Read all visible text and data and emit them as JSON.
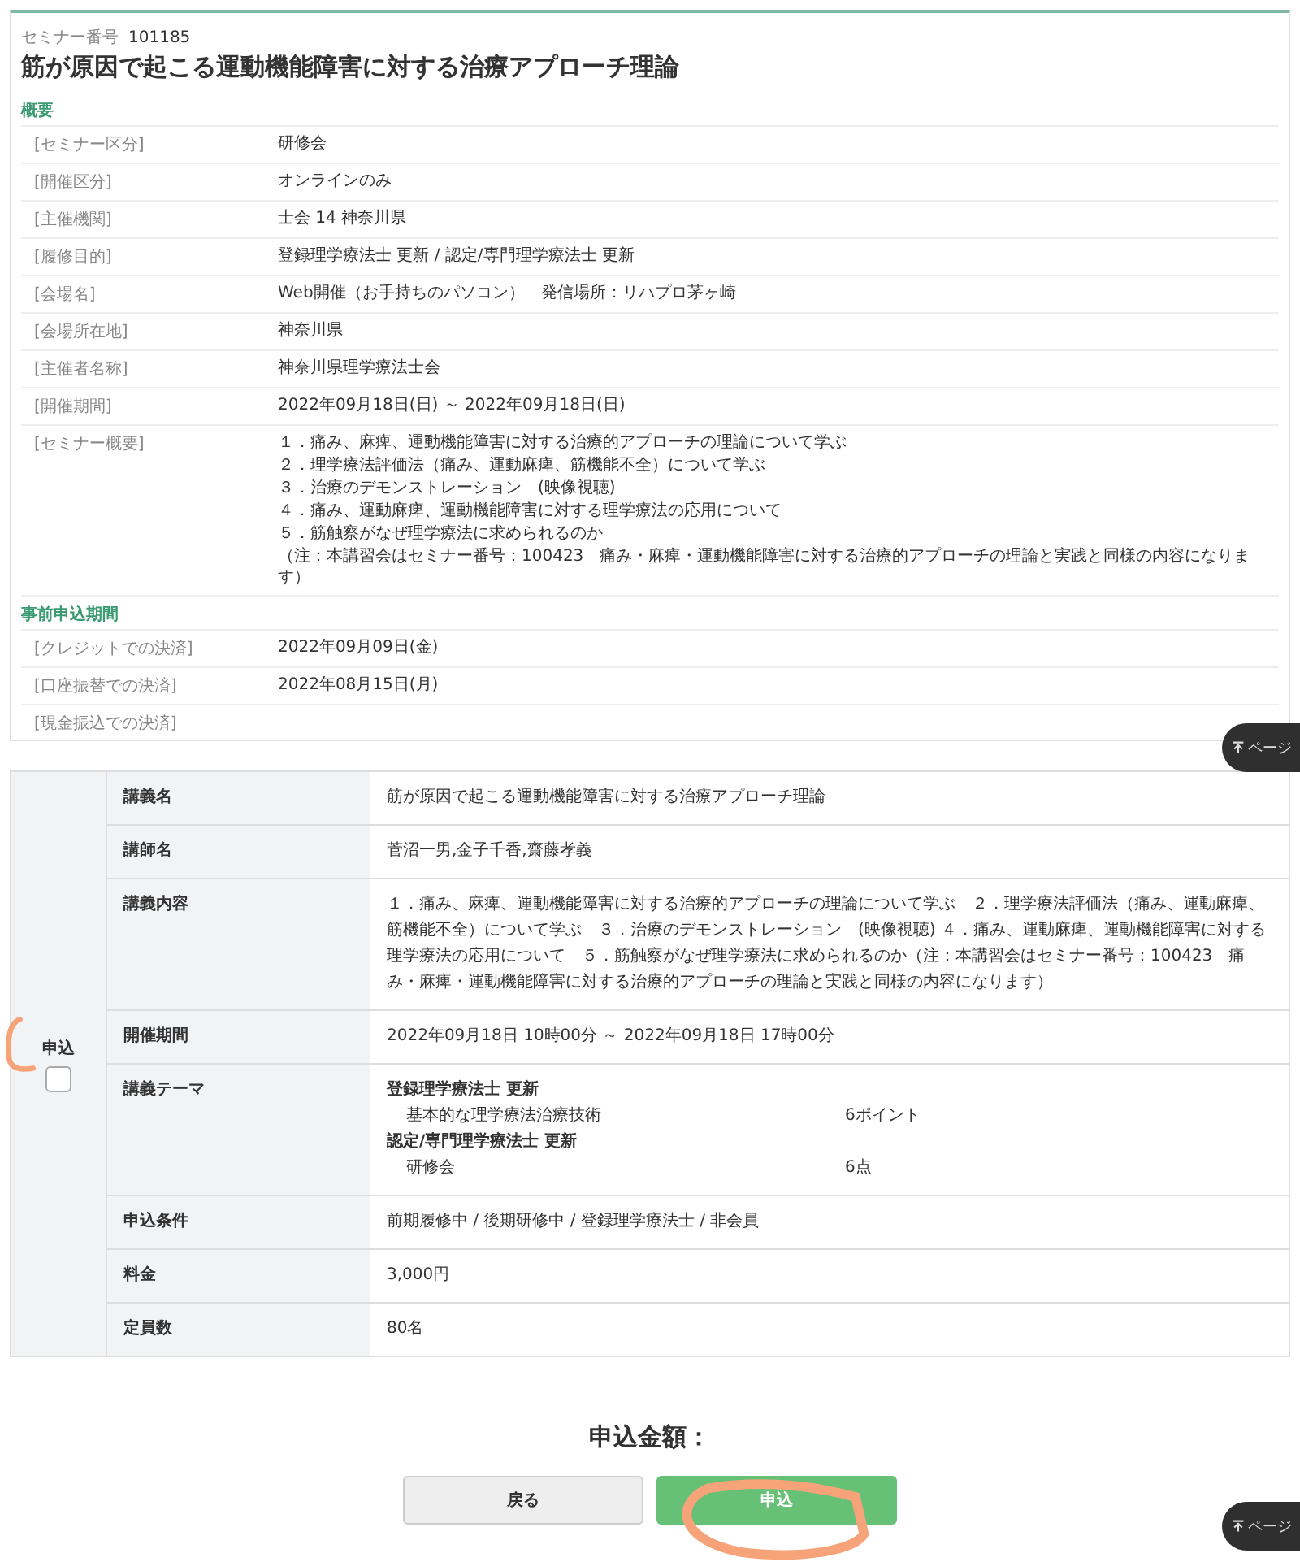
{
  "seminar_number": {
    "label": "セミナー番号",
    "value": "101185"
  },
  "title": "筋が原因で起こる運動機能障害に対する治療アプローチ理論",
  "overview": {
    "heading": "概要",
    "rows": [
      {
        "label": "[セミナー区分]",
        "value": "研修会"
      },
      {
        "label": "[開催区分]",
        "value": "オンラインのみ"
      },
      {
        "label": "[主催機関]",
        "value": "士会 14 神奈川県"
      },
      {
        "label": "[履修目的]",
        "value": "登録理学療法士 更新 / 認定/専門理学療法士 更新"
      },
      {
        "label": "[会場名]",
        "value": "Web開催（お手持ちのパソコン）　発信場所：リハプロ茅ヶ崎"
      },
      {
        "label": "[会場所在地]",
        "value": "神奈川県"
      },
      {
        "label": "[主催者名称]",
        "value": "神奈川県理学療法士会"
      },
      {
        "label": "[開催期間]",
        "value": "2022年09月18日(日) ～ 2022年09月18日(日)"
      },
      {
        "label": "[セミナー概要]",
        "lines": [
          "１．痛み、麻痺、運動機能障害に対する治療的アプローチの理論について学ぶ",
          "２．理学療法評価法（痛み、運動麻痺、筋機能不全）について学ぶ",
          "３．治療のデモンストレーション　(映像視聴)",
          "４．痛み、運動麻痺、運動機能障害に対する理学療法の応用について",
          "５．筋触察がなぜ理学療法に求められるのか",
          "（注：本講習会はセミナー番号：100423　痛み・麻痺・運動機能障害に対する治療的アプローチの理論と実践と同様の内容になります）"
        ]
      }
    ]
  },
  "application_period": {
    "heading": "事前申込期間",
    "rows": [
      {
        "label": "[クレジットでの決済]",
        "value": "2022年09月09日(金)"
      },
      {
        "label": "[口座振替での決済]",
        "value": "2022年08月15日(月)"
      },
      {
        "label": "[現金振込での決済]"
      }
    ]
  },
  "course": {
    "apply_label": "申込",
    "apply_checked": false,
    "rows": [
      {
        "label": "講義名",
        "value": "筋が原因で起こる運動機能障害に対する治療アプローチ理論"
      },
      {
        "label": "講師名",
        "value": "菅沼一男,金子千香,齋藤孝義"
      },
      {
        "label": "講義内容",
        "value": "１．痛み、麻痺、運動機能障害に対する治療的アプローチの理論について学ぶ　２．理学療法評価法（痛み、運動麻痺、筋機能不全）について学ぶ　３．治療のデモンストレーション　(映像視聴) ４．痛み、運動麻痺、運動機能障害に対する理学療法の応用について　５．筋触察がなぜ理学療法に求められるのか（注：本講習会はセミナー番号：100423　痛み・麻痺・運動機能障害に対する治療的アプローチの理論と実践と同様の内容になります）"
      },
      {
        "label": "開催期間",
        "value": "2022年09月18日 10時00分 ～ 2022年09月18日 17時00分"
      },
      {
        "label": "講義テーマ",
        "groups": [
          {
            "title": "登録理学療法士 更新",
            "items": [
              {
                "name": "基本的な理学療法治療技術",
                "points": "6ポイント"
              }
            ]
          },
          {
            "title": "認定/専門理学療法士 更新",
            "items": [
              {
                "name": "研修会",
                "points": "6点"
              }
            ]
          }
        ]
      },
      {
        "label": "申込条件",
        "value": "前期履修中 / 後期研修中 / 登録理学療法士 / 非会員"
      },
      {
        "label": "料金",
        "value": "3,000円"
      },
      {
        "label": "定員数",
        "value": "80名"
      }
    ]
  },
  "total": "申込金額：",
  "buttons": [
    {
      "label": "戻る",
      "kind": "secondary"
    },
    {
      "label": "申込",
      "kind": "primary"
    }
  ],
  "page_top": [
    "ページ",
    "ページ"
  ]
}
